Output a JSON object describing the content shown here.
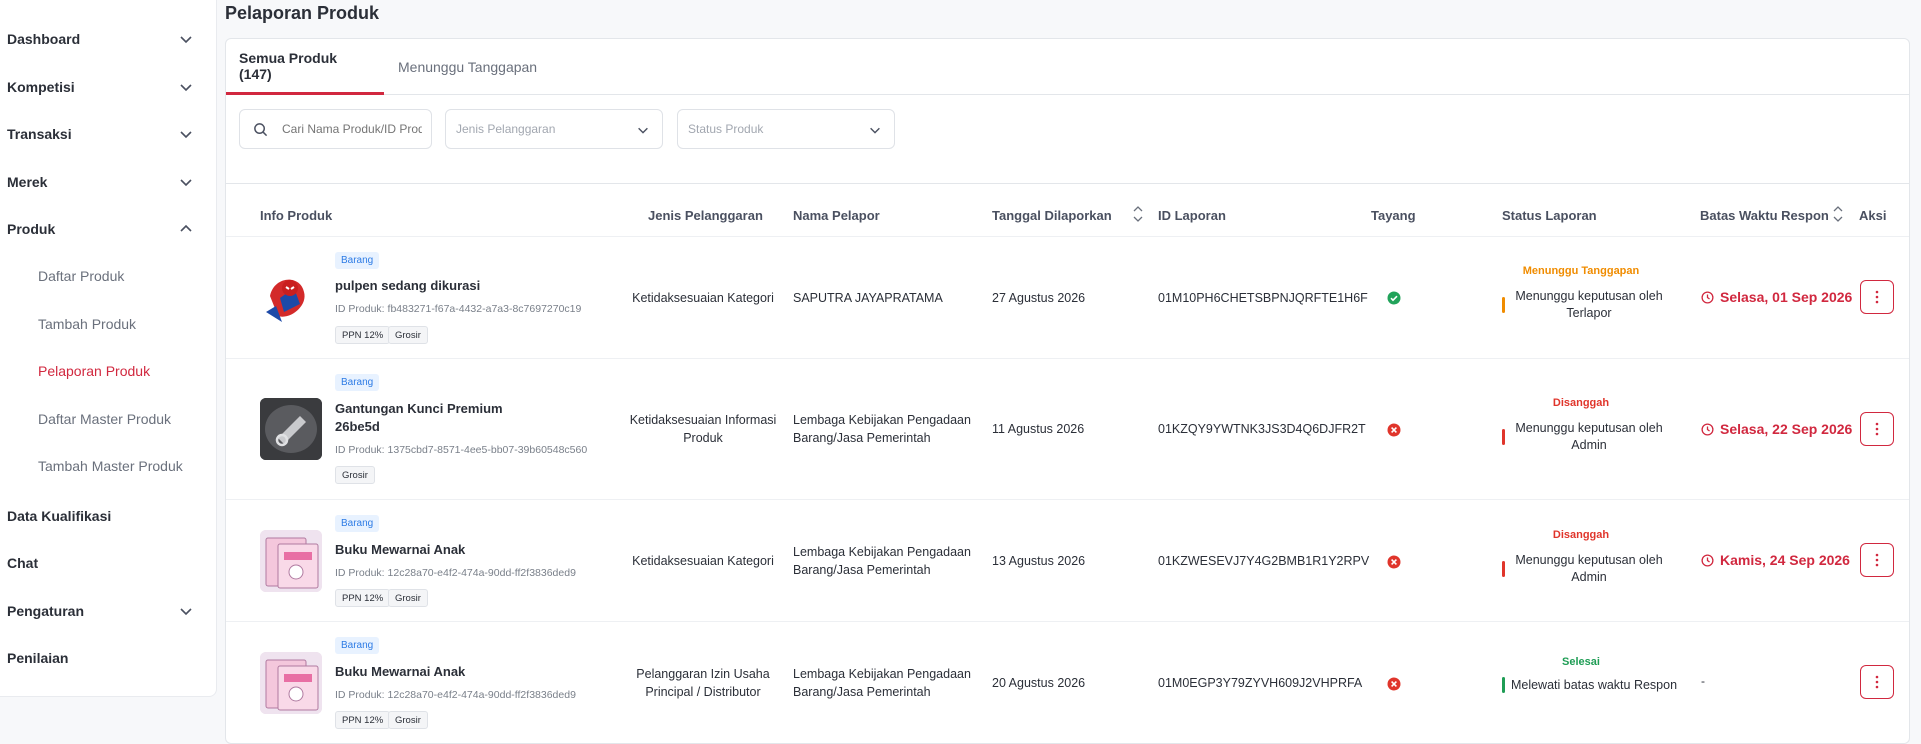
{
  "sidebar": {
    "items": [
      {
        "label": "Dashboard"
      },
      {
        "label": "Kompetisi"
      },
      {
        "label": "Transaksi"
      },
      {
        "label": "Merek"
      },
      {
        "label": "Produk"
      },
      {
        "label": "Data Kualifikasi"
      },
      {
        "label": "Chat"
      },
      {
        "label": "Pengaturan"
      },
      {
        "label": "Penilaian"
      }
    ],
    "produk_sub": [
      {
        "label": "Daftar Produk"
      },
      {
        "label": "Tambah Produk"
      },
      {
        "label": "Pelaporan Produk"
      },
      {
        "label": "Daftar Master Produk"
      },
      {
        "label": "Tambah Master Produk"
      }
    ]
  },
  "page_title": "Pelaporan Produk",
  "tabs": [
    {
      "label": "Semua Produk (147)"
    },
    {
      "label": "Menunggu Tanggapan"
    }
  ],
  "filters": {
    "search_placeholder": "Cari Nama Produk/ID Produk",
    "customer_type_placeholder": "Jenis Pelanggaran",
    "product_status_placeholder": "Status Produk"
  },
  "table": {
    "headers": {
      "info": "Info Produk",
      "jenis": "Jenis Pelanggaran",
      "pelapor": "Nama Pelapor",
      "tanggal": "Tanggal Dilaporkan",
      "id_laporan": "ID Laporan",
      "tayang": "Tayang",
      "status": "Status Laporan",
      "batas": "Batas Waktu Respon",
      "aksi": "Aksi"
    },
    "rows": [
      {
        "category": "Barang",
        "name": "pulpen sedang dikurasi",
        "product_id": "ID Produk: fb483271-f67a-4432-a7a3-8c7697270c19",
        "tags": [
          "PPN 12%",
          "Grosir"
        ],
        "jenis": "Ketidaksesuaian Kategori",
        "pelapor": "SAPUTRA JAYAPRATAMA",
        "tanggal": "27 Agustus 2026",
        "id_laporan": "01M10PH6CHETSBPNJQRFTE1H6F",
        "tayang": "yes",
        "status_label": "Menunggu Tanggapan",
        "status_color": "#f08c00",
        "status_desc": "Menunggu keputusan oleh Terlapor",
        "deadline": "Selasa, 01 Sep 2026"
      },
      {
        "category": "Barang",
        "name": "Gantungan Kunci Premium 26be5d",
        "product_id": "ID Produk: 1375cbd7-8571-4ee5-bb07-39b60548c560",
        "tags": [
          "Grosir"
        ],
        "jenis": "Ketidaksesuaian Informasi Produk",
        "pelapor": "Lembaga Kebijakan Pengadaan Barang/Jasa Pemerintah",
        "tanggal": "11 Agustus 2026",
        "id_laporan": "01KZQY9YWTNK3JS3D4Q6DJFR2T",
        "tayang": "no",
        "status_label": "Disanggah",
        "status_color": "#e0352b",
        "status_desc": "Menunggu keputusan oleh Admin",
        "deadline": "Selasa, 22 Sep 2026"
      },
      {
        "category": "Barang",
        "name": "Buku Mewarnai Anak",
        "product_id": "ID Produk: 12c28a70-e4f2-474a-90dd-ff2f3836ded9",
        "tags": [
          "PPN 12%",
          "Grosir"
        ],
        "jenis": "Ketidaksesuaian Kategori",
        "pelapor": "Lembaga Kebijakan Pengadaan Barang/Jasa Pemerintah",
        "tanggal": "13 Agustus 2026",
        "id_laporan": "01KZWESEVJ7Y4G2BMB1R1Y2RPV",
        "tayang": "no",
        "status_label": "Disanggah",
        "status_color": "#e0352b",
        "status_desc": "Menunggu keputusan oleh Admin",
        "deadline": "Kamis, 24 Sep 2026"
      },
      {
        "category": "Barang",
        "name": "Buku Mewarnai Anak",
        "product_id": "ID Produk: 12c28a70-e4f2-474a-90dd-ff2f3836ded9",
        "tags": [
          "PPN 12%",
          "Grosir"
        ],
        "jenis": "Pelanggaran Izin Usaha Principal / Distributor",
        "pelapor": "Lembaga Kebijakan Pengadaan Barang/Jasa Pemerintah",
        "tanggal": "20 Agustus 2026",
        "id_laporan": "01M0EGP3Y79ZYVH609J2VHPRFA",
        "tayang": "no",
        "status_label": "Selesai",
        "status_color": "#1f9d55",
        "status_desc": "Melewati batas waktu Respon",
        "deadline": "-"
      }
    ]
  },
  "colors": {
    "accent": "#d1283f",
    "check_green": "#21a35a",
    "cross_red": "#e0352b"
  }
}
